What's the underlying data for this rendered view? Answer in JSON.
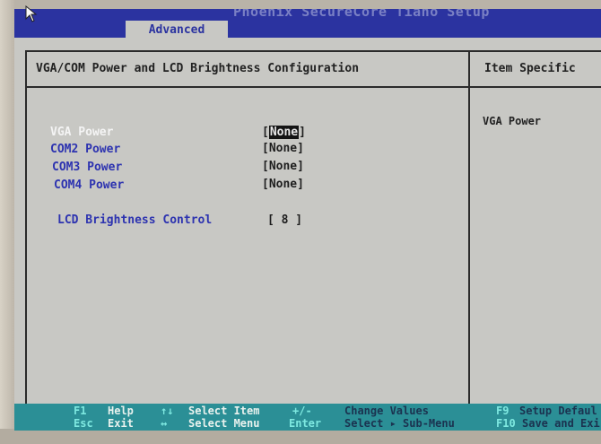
{
  "header": {
    "title": "Phoenix SecureCore Tiano Setup",
    "active_tab": "Advanced"
  },
  "main": {
    "heading": "VGA/COM Power and LCD Brightness Configuration",
    "items": [
      {
        "label": "VGA Power",
        "value": "None",
        "selected": true
      },
      {
        "label": "COM2 Power",
        "value": "[None]"
      },
      {
        "label": "COM3 Power",
        "value": "[None]"
      },
      {
        "label": "COM4 Power",
        "value": "[None]"
      },
      {
        "label": "LCD Brightness Control",
        "value": "[ 8 ]"
      }
    ]
  },
  "side": {
    "heading": "Item Specific",
    "help": "VGA Power"
  },
  "footer": {
    "f1_key": "F1",
    "f1_desc": "Help",
    "esc_key": "Esc",
    "esc_desc": "Exit",
    "updown_key": "↑↓",
    "updown_desc": "Select Item",
    "leftright_key": "↔",
    "leftright_desc": "Select Menu",
    "plusminus_key": "+/-",
    "plusminus_desc": "Change Values",
    "enter_key": "Enter",
    "enter_desc": "Select ▸ Sub-Menu",
    "f9_key": "F9",
    "f9_desc": "Setup Defaul",
    "f10_key": "F10",
    "f10_desc": "Save and Exi"
  }
}
